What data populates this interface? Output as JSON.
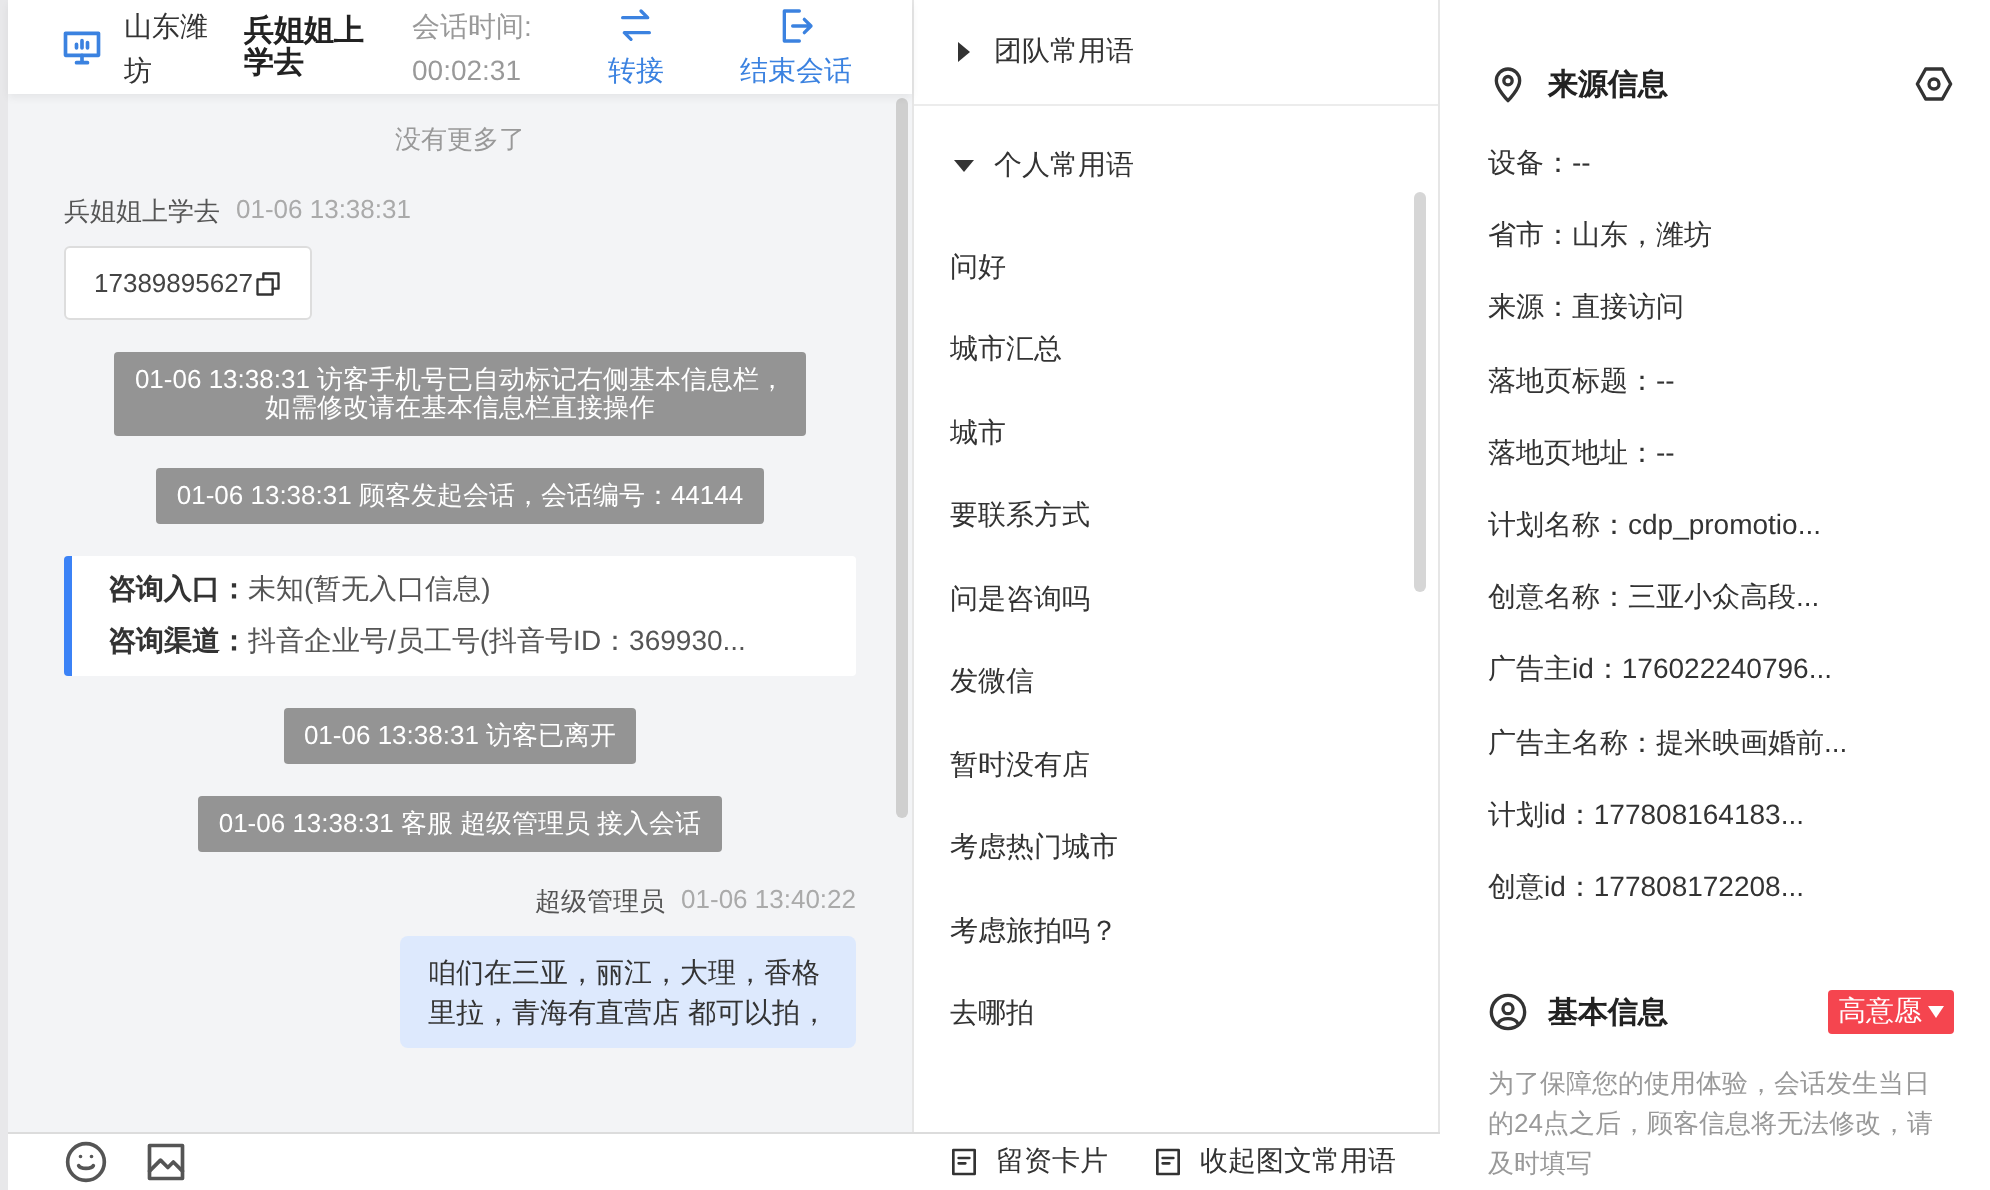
{
  "header": {
    "location": "山东潍坊",
    "visitor": "兵姐姐上学去",
    "timer_label": "会话时间:",
    "timer": "00:02:31",
    "actions": [
      {
        "label": "转接",
        "kind": "transfer"
      },
      {
        "label": "结束会话",
        "kind": "end"
      }
    ]
  },
  "chat": {
    "no_more": "没有更多了",
    "messages": [
      {
        "kind": "visitor",
        "sender": "兵姐姐上学去",
        "time": "01-06 13:38:31",
        "text": "17389895627"
      },
      {
        "kind": "system",
        "lines": [
          "01-06 13:38:31 访客手机号已自动标记右侧基本信息栏，",
          "如需修改请在基本信息栏直接操作"
        ]
      },
      {
        "kind": "system",
        "text": "01-06 13:38:31 顾客发起会话，会话编号：44144"
      },
      {
        "kind": "info",
        "rows": [
          {
            "label": "咨询入口：",
            "value": "未知(暂无入口信息)"
          },
          {
            "label": "咨询渠道：",
            "value": "抖音企业号/员工号(抖音号ID：369930..."
          }
        ]
      },
      {
        "kind": "system",
        "text": "01-06 13:38:31 访客已离开"
      },
      {
        "kind": "system",
        "text": "01-06 13:38:31 客服 超级管理员 接入会话"
      },
      {
        "kind": "agent",
        "sender": "超级管理员",
        "time": "01-06 13:40:22",
        "text": "咱们在三亚，丽江，大理，香格里拉，青海有直营店 都可以拍，"
      }
    ]
  },
  "phrases": {
    "groups": [
      {
        "title": "团队常用语",
        "expanded": false
      },
      {
        "title": "个人常用语",
        "expanded": true,
        "items": [
          "问好",
          "城市汇总",
          "城市",
          "要联系方式",
          "问是咨询吗",
          "发微信",
          "暂时没有店",
          "考虑热门城市",
          "考虑旅拍吗？",
          "去哪拍"
        ]
      }
    ]
  },
  "toolbar": {
    "buttons": [
      "留资卡片",
      "收起图文常用语"
    ]
  },
  "source": {
    "title": "来源信息",
    "fields": [
      "设备：--",
      "省市：山东，潍坊",
      "来源：直接访问",
      "落地页标题：--",
      "落地页地址：--",
      "计划名称：cdp_promotio...",
      "创意名称：三亚小众高段...",
      "广告主id：176022240796...",
      "广告主名称：提米映画婚前...",
      "计划id：177808164183...",
      "创意id：177808172208..."
    ]
  },
  "basic": {
    "title": "基本信息",
    "tag": "高意愿",
    "note": "为了保障您的使用体验，会话发生当日的24点之后，顾客信息将无法修改，请及时填写"
  }
}
